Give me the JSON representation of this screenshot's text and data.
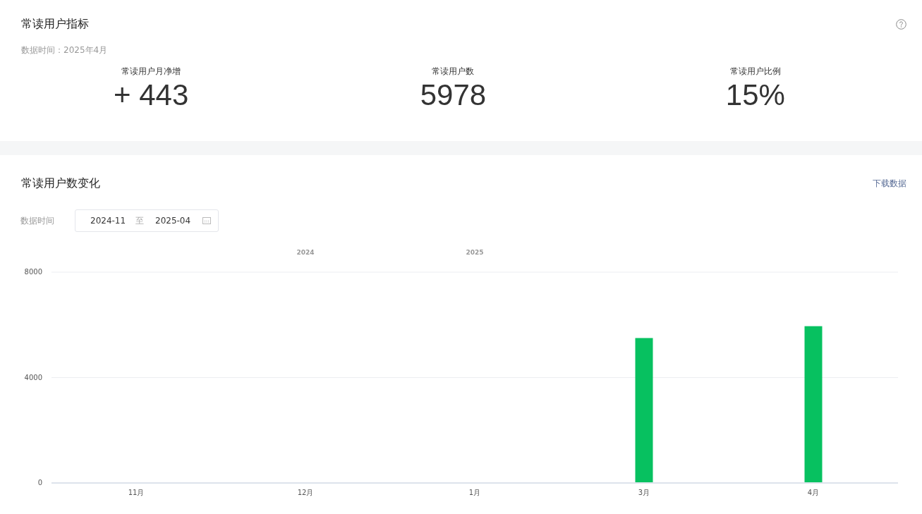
{
  "metrics_card": {
    "title": "常读用户指标",
    "data_time": "数据时间：2025年4月",
    "metrics": [
      {
        "label": "常读用户月净增",
        "value": "+ 443"
      },
      {
        "label": "常读用户数",
        "value": "5978"
      },
      {
        "label": "常读用户比例",
        "value": "15%"
      }
    ]
  },
  "trend_card": {
    "title": "常读用户数变化",
    "download_link": "下载数据",
    "date_filter": {
      "label": "数据时间",
      "start": "2024-11",
      "separator": "至",
      "end": "2025-04"
    },
    "chart_data": {
      "type": "bar",
      "categories": [
        "11月",
        "12月",
        "1月",
        "3月",
        "4月"
      ],
      "series": [
        {
          "color": "#07c160",
          "values": [
            0,
            0,
            0,
            5500,
            5950
          ]
        }
      ],
      "ylim": [
        0,
        8000
      ],
      "yticks": [
        0,
        4000,
        8000
      ],
      "annotations": [
        "2024",
        "2025"
      ]
    }
  }
}
